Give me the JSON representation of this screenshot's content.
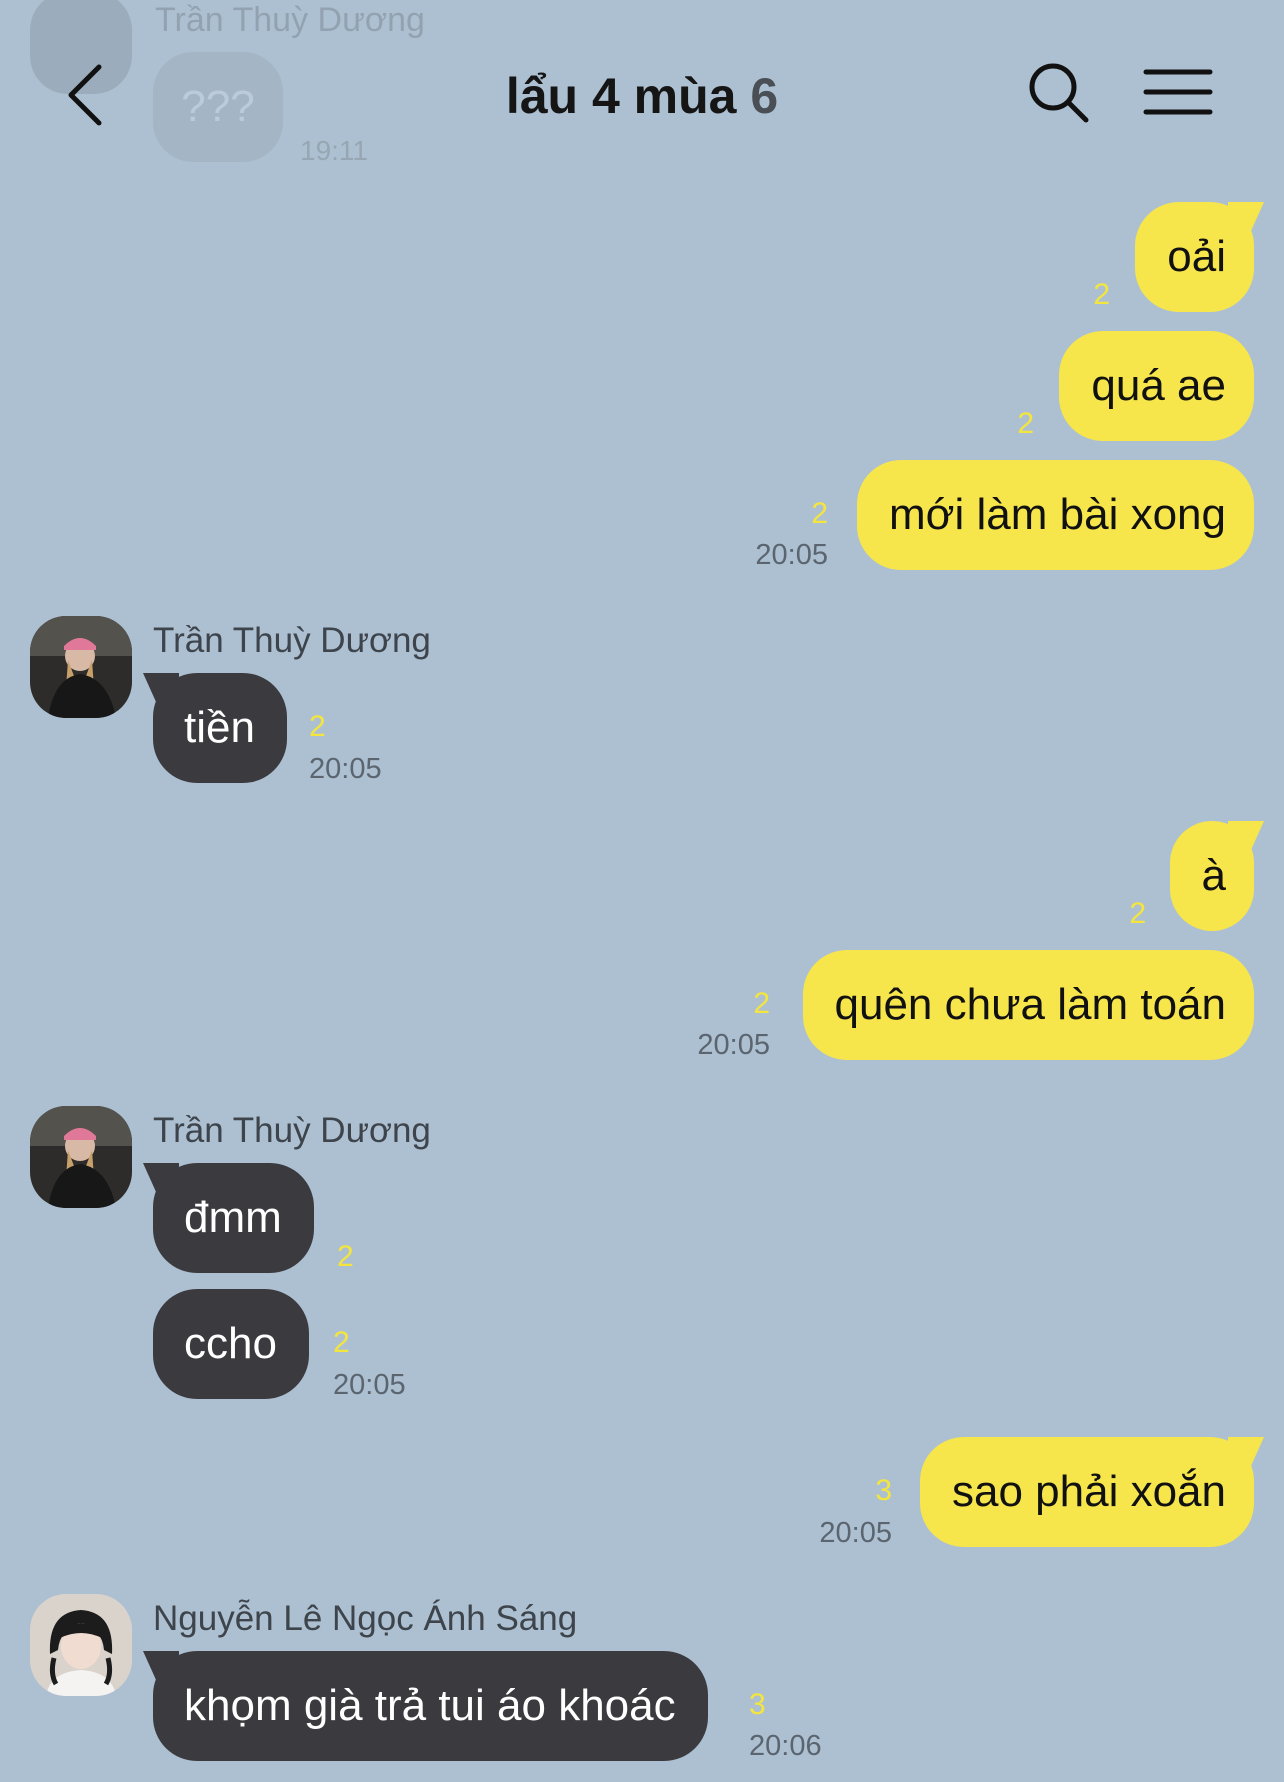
{
  "header": {
    "title": "lẩu 4 mùa",
    "member_count": "6"
  },
  "ghost": {
    "sender": "Trần Thuỳ Dương",
    "text": "???",
    "time": "19:11"
  },
  "colors": {
    "background": "#adc0d1",
    "my_bubble": "#f6e64b",
    "their_bubble": "#3b3b3f",
    "unread": "#f4e53e"
  },
  "messages": {
    "m1": {
      "text": "oải",
      "unread": "2"
    },
    "m2": {
      "text": "quá ae",
      "unread": "2"
    },
    "m3": {
      "text": "mới làm bài xong",
      "unread": "2",
      "time": "20:05"
    },
    "s1": {
      "sender": "Trần Thuỳ Dương",
      "text": "tiền",
      "unread": "2",
      "time": "20:05"
    },
    "m4": {
      "text": "à",
      "unread": "2"
    },
    "m5": {
      "text": "quên chưa làm toán",
      "unread": "2",
      "time": "20:05"
    },
    "s2": {
      "sender": "Trần Thuỳ Dương"
    },
    "s2a": {
      "text": "đmm",
      "unread": "2"
    },
    "s2b": {
      "text": "ccho",
      "unread": "2",
      "time": "20:05"
    },
    "m6": {
      "text": "sao phải xoắn",
      "unread": "3",
      "time": "20:05"
    },
    "s3": {
      "sender": "Nguyễn Lê Ngọc Ánh Sáng",
      "text": "khọm già trả tui áo khoác",
      "unread": "3",
      "time": "20:06"
    }
  }
}
